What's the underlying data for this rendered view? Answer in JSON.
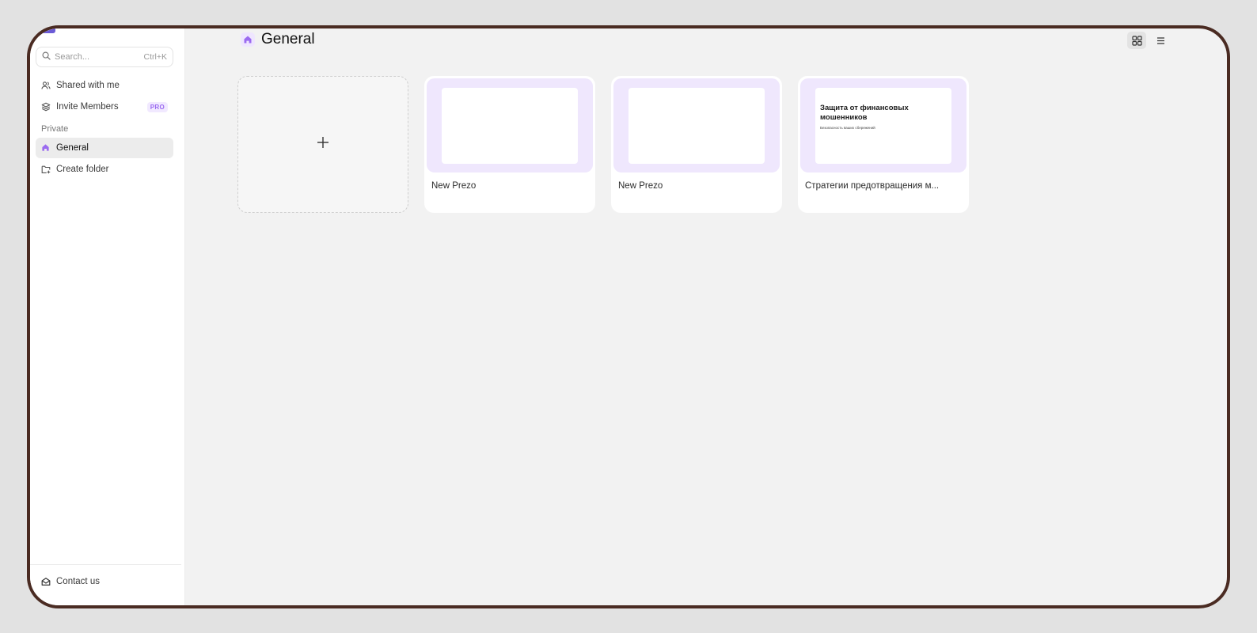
{
  "sidebar": {
    "search": {
      "placeholder": "Search...",
      "shortcut": "Ctrl+K"
    },
    "items": [
      {
        "label": "Shared with me",
        "icon": "users-icon"
      },
      {
        "label": "Invite Members",
        "icon": "stack-icon",
        "badge": "PRO"
      }
    ],
    "section_label": "Private",
    "folders": [
      {
        "label": "General",
        "icon": "home-icon",
        "active": true
      },
      {
        "label": "Create folder",
        "icon": "folder-plus-icon"
      }
    ],
    "footer": {
      "label": "Contact us",
      "icon": "mail-open-icon"
    }
  },
  "header": {
    "title": "General",
    "icon": "home-icon",
    "view_modes": [
      "grid-view-icon",
      "list-view-icon"
    ],
    "active_view": "grid"
  },
  "cards": [
    {
      "label": "New Prezo"
    },
    {
      "label": "New Prezo"
    },
    {
      "label": "Стратегии предотвращения м...",
      "slide_title": "Защита от финансовых мошенников",
      "slide_subtitle": "Безопасность ваших сбережений"
    }
  ],
  "colors": {
    "accent": "#9b6bf0",
    "thumb_bg": "#efe7fd",
    "frame": "#4a2b22",
    "canvas": "#f2f2f2"
  }
}
